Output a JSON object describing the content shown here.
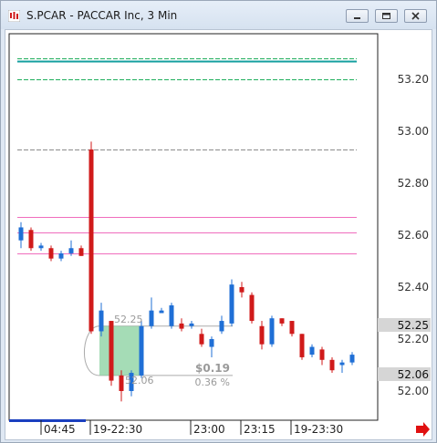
{
  "window": {
    "title": "S.PCAR - PACCAR Inc, 3 Min",
    "buttons": [
      "minimize-icon",
      "restore-icon",
      "close-icon"
    ]
  },
  "colors": {
    "up": "#1f6fd6",
    "down": "#d01a1a",
    "green_line": "#1fae5c",
    "teal_line": "#139f9f",
    "gray_line": "#8c8c8c",
    "pink_line": "#f06dbd",
    "price_tag_bg": "#d6d6d6",
    "selection_fill": "#8fd3a4"
  },
  "chart_data": {
    "type": "candlestick",
    "title": "",
    "y_ticks": [
      "53.20",
      "53.00",
      "52.80",
      "52.60",
      "52.40",
      "52.20",
      "52.00"
    ],
    "x_ticks": [
      "04:45",
      "19-22:30",
      "23:00",
      "23:15",
      "19-23:30"
    ],
    "price_tags": [
      "52.25",
      "52.06"
    ],
    "ylim": [
      51.95,
      53.32
    ],
    "h_lines": [
      {
        "price": 53.28,
        "color": "green",
        "style": "dashed"
      },
      {
        "price": 53.27,
        "color": "teal",
        "style": "solid"
      },
      {
        "price": 53.2,
        "color": "green",
        "style": "dashed"
      },
      {
        "price": 52.93,
        "color": "gray",
        "style": "dashed"
      },
      {
        "price": 52.67,
        "color": "pink",
        "style": "solid"
      },
      {
        "price": 52.61,
        "color": "pink",
        "style": "solid"
      },
      {
        "price": 52.53,
        "color": "pink",
        "style": "solid"
      }
    ],
    "candles": [
      {
        "o": 52.58,
        "h": 52.65,
        "l": 52.55,
        "c": 52.63
      },
      {
        "o": 52.62,
        "h": 52.63,
        "l": 52.54,
        "c": 52.55
      },
      {
        "o": 52.55,
        "h": 52.57,
        "l": 52.54,
        "c": 52.56
      },
      {
        "o": 52.55,
        "h": 52.56,
        "l": 52.5,
        "c": 52.51
      },
      {
        "o": 52.51,
        "h": 52.54,
        "l": 52.5,
        "c": 52.53
      },
      {
        "o": 52.53,
        "h": 52.58,
        "l": 52.52,
        "c": 52.55
      },
      {
        "o": 52.55,
        "h": 52.56,
        "l": 52.52,
        "c": 52.52
      },
      {
        "o": 52.93,
        "h": 52.96,
        "l": 52.22,
        "c": 52.23
      },
      {
        "o": 52.23,
        "h": 52.34,
        "l": 52.21,
        "c": 52.31
      },
      {
        "o": 52.27,
        "h": 52.27,
        "l": 52.02,
        "c": 52.04
      },
      {
        "o": 52.06,
        "h": 52.08,
        "l": 51.96,
        "c": 52.0
      },
      {
        "o": 52.0,
        "h": 52.08,
        "l": 51.98,
        "c": 52.07
      },
      {
        "o": 52.06,
        "h": 52.27,
        "l": 52.05,
        "c": 52.25
      },
      {
        "o": 52.25,
        "h": 52.36,
        "l": 52.24,
        "c": 52.31
      },
      {
        "o": 52.3,
        "h": 52.32,
        "l": 52.3,
        "c": 52.31
      },
      {
        "o": 52.25,
        "h": 52.34,
        "l": 52.24,
        "c": 52.33
      },
      {
        "o": 52.26,
        "h": 52.28,
        "l": 52.23,
        "c": 52.24
      },
      {
        "o": 52.25,
        "h": 52.27,
        "l": 52.24,
        "c": 52.26
      },
      {
        "o": 52.22,
        "h": 52.24,
        "l": 52.17,
        "c": 52.18
      },
      {
        "o": 52.17,
        "h": 52.21,
        "l": 52.13,
        "c": 52.2
      },
      {
        "o": 52.23,
        "h": 52.29,
        "l": 52.22,
        "c": 52.27
      },
      {
        "o": 52.26,
        "h": 52.43,
        "l": 52.25,
        "c": 52.41
      },
      {
        "o": 52.4,
        "h": 52.42,
        "l": 52.36,
        "c": 52.38
      },
      {
        "o": 52.37,
        "h": 52.38,
        "l": 52.26,
        "c": 52.27
      },
      {
        "o": 52.25,
        "h": 52.27,
        "l": 52.16,
        "c": 52.18
      },
      {
        "o": 52.18,
        "h": 52.29,
        "l": 52.17,
        "c": 52.28
      },
      {
        "o": 52.28,
        "h": 52.28,
        "l": 52.25,
        "c": 52.26
      },
      {
        "o": 52.27,
        "h": 52.27,
        "l": 52.21,
        "c": 52.22
      },
      {
        "o": 52.22,
        "h": 52.22,
        "l": 52.12,
        "c": 52.13
      },
      {
        "o": 52.14,
        "h": 52.18,
        "l": 52.13,
        "c": 52.17
      },
      {
        "o": 52.16,
        "h": 52.17,
        "l": 52.1,
        "c": 52.12
      },
      {
        "o": 52.12,
        "h": 52.13,
        "l": 52.07,
        "c": 52.08
      },
      {
        "o": 52.1,
        "h": 52.12,
        "l": 52.07,
        "c": 52.11
      },
      {
        "o": 52.11,
        "h": 52.15,
        "l": 52.1,
        "c": 52.14
      }
    ],
    "annotation": {
      "start_label": "52.25",
      "end_label": "52.06",
      "change_dollar": "$0.19",
      "change_percent": "0.36 %"
    }
  }
}
